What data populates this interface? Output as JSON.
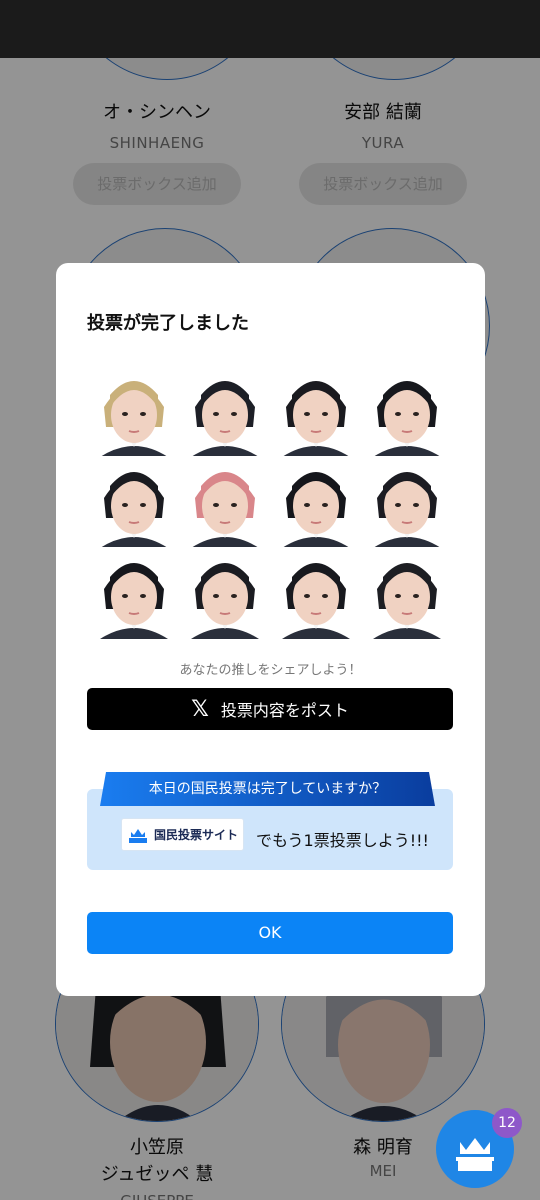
{
  "background": {
    "candidates_top": [
      {
        "name": "オ・シンヘン",
        "roman": "SHINHAENG",
        "vote_add": "投票ボックス追加"
      },
      {
        "name": "安部 結蘭",
        "roman": "YURA",
        "vote_add": "投票ボックス追加"
      }
    ],
    "candidates_bottom": [
      {
        "name_line1": "小笠原",
        "name_line2": "ジュゼッペ 慧",
        "roman": "GIUSEPPE"
      },
      {
        "name_line1": "森 明育",
        "roman": "MEI"
      }
    ],
    "fab": {
      "icon": "crown-ballot-icon",
      "badge_count": "12",
      "color": "#1f86e6",
      "badge_color": "#8e58c9"
    }
  },
  "modal": {
    "title": "投票が完了しました",
    "voted_portraits": [
      {
        "hair": "#c9b07a"
      },
      {
        "hair": "#1d1f26"
      },
      {
        "hair": "#1a1a1f"
      },
      {
        "hair": "#17181d"
      },
      {
        "hair": "#1a1b20"
      },
      {
        "hair": "#d9868a"
      },
      {
        "hair": "#15161b"
      },
      {
        "hair": "#1c1c22"
      },
      {
        "hair": "#16171c"
      },
      {
        "hair": "#1b1c21"
      },
      {
        "hair": "#18191e"
      },
      {
        "hair": "#1d1e23"
      }
    ],
    "share_hint": "あなたの推しをシェアしよう！",
    "post_button": {
      "icon": "x-logo-icon",
      "label": "投票内容をポスト"
    },
    "national_vote": {
      "ribbon": "本日の国民投票は完了していますか？",
      "site_badge": "国民投票サイト",
      "cta": "でもう1票投票しよう!!!"
    },
    "ok_button": "OK"
  },
  "colors": {
    "accent": "#0b84f6",
    "post_bg": "#000000",
    "banner_bg": "#cfe5fb",
    "ribbon": "#1565d8"
  }
}
